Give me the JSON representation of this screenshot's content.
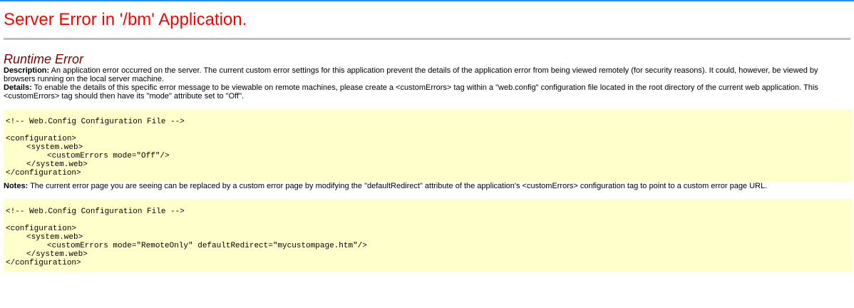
{
  "title": "Server Error in '/bm' Application.",
  "subtitle": "Runtime Error",
  "description": {
    "label": "Description:",
    "text": " An application error occurred on the server. The current custom error settings for this application prevent the details of the application error from being viewed remotely (for security reasons). It could, however, be viewed by browsers running on the local server machine."
  },
  "details": {
    "label": "Details:",
    "text": " To enable the details of this specific error message to be viewable on remote machines, please create a <customErrors> tag within a \"web.config\" configuration file located in the root directory of the current web application. This <customErrors> tag should then have its \"mode\" attribute set to \"Off\"."
  },
  "code1": {
    "comment": "<!-- Web.Config Configuration File -->",
    "line1": "<configuration>",
    "line2": "<system.web>",
    "line3": "<customErrors mode=\"Off\"/>",
    "line4": "</system.web>",
    "line5": "</configuration>"
  },
  "notes": {
    "label": "Notes:",
    "text": " The current error page you are seeing can be replaced by a custom error page by modifying the \"defaultRedirect\" attribute of the application's <customErrors> configuration tag to point to a custom error page URL."
  },
  "code2": {
    "comment": "<!-- Web.Config Configuration File -->",
    "line1": "<configuration>",
    "line2": "<system.web>",
    "line3": "<customErrors mode=\"RemoteOnly\" defaultRedirect=\"mycustompage.htm\"/>",
    "line4": "</system.web>",
    "line5": "</configuration>"
  },
  "colors": {
    "top_bar": "#1e90ff",
    "title": "#ff0000",
    "subtitle": "#800000",
    "code_background": "#ffffcc",
    "rule": "#c0c0c0"
  }
}
